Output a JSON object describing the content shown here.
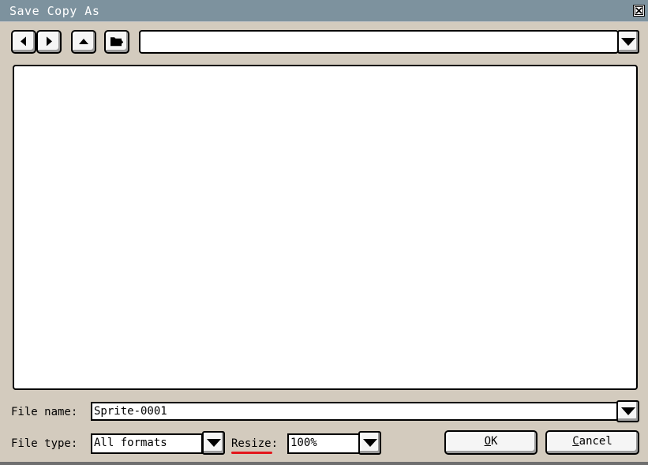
{
  "window": {
    "title": "Save Copy As"
  },
  "toolbar": {
    "path_value": ""
  },
  "file_name": {
    "label": "File name:",
    "value": "Sprite-0001"
  },
  "file_type": {
    "label": "File type:",
    "value": "All formats"
  },
  "resize": {
    "label": "Resize:",
    "value": "100%"
  },
  "buttons": {
    "ok_underlined": "O",
    "ok_rest": "K",
    "cancel_underlined": "C",
    "cancel_rest": "ancel"
  },
  "colors": {
    "titlebar": "#7d929e",
    "background": "#d3cbbe",
    "accent_underline": "#e3161c"
  }
}
